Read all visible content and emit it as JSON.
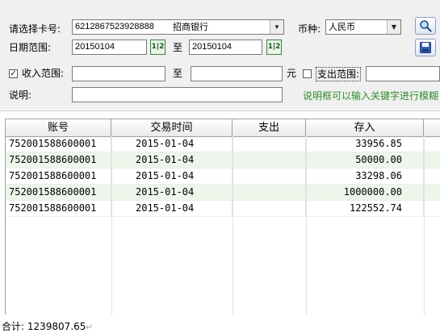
{
  "filters": {
    "card_label": "请选择卡号:",
    "card_value": "6212867523928888",
    "card_bank": "招商银行",
    "currency_label": "币种:",
    "currency_value": "人民币",
    "date_label": "日期范围:",
    "date_from": "20150104",
    "date_to_label": "至",
    "date_to": "20150104",
    "calendar_icon_text": "1|2",
    "income_label": "收入范围:",
    "income_checked": "✓",
    "income_from": "",
    "income_to_label": "至",
    "income_to": "",
    "income_unit": "元",
    "expense_label": "支出范围:",
    "expense_from": "",
    "desc_label": "说明:",
    "desc_value": "",
    "desc_hint": "说明框可以输入关键字进行模糊"
  },
  "toolbar": {
    "search_icon": "search-icon",
    "save_icon": "save-icon"
  },
  "table": {
    "columns": [
      "账号",
      "交易时间",
      "支出",
      "存入"
    ],
    "rows": [
      {
        "account": "752001588600001",
        "time": "2015-01-04",
        "expense": "",
        "deposit": "33956.85"
      },
      {
        "account": "752001588600001",
        "time": "2015-01-04",
        "expense": "",
        "deposit": "50000.00"
      },
      {
        "account": "752001588600001",
        "time": "2015-01-04",
        "expense": "",
        "deposit": "33298.06"
      },
      {
        "account": "752001588600001",
        "time": "2015-01-04",
        "expense": "",
        "deposit": "1000000.00"
      },
      {
        "account": "752001588600001",
        "time": "2015-01-04",
        "expense": "",
        "deposit": "122552.74"
      }
    ]
  },
  "footer": {
    "total_label": "合计:",
    "total_value": "1239807.65"
  },
  "colors": {
    "panel_bg": "#f0f0f0",
    "alt_row": "#eef5ea",
    "hint_text": "#2e8b2e"
  }
}
